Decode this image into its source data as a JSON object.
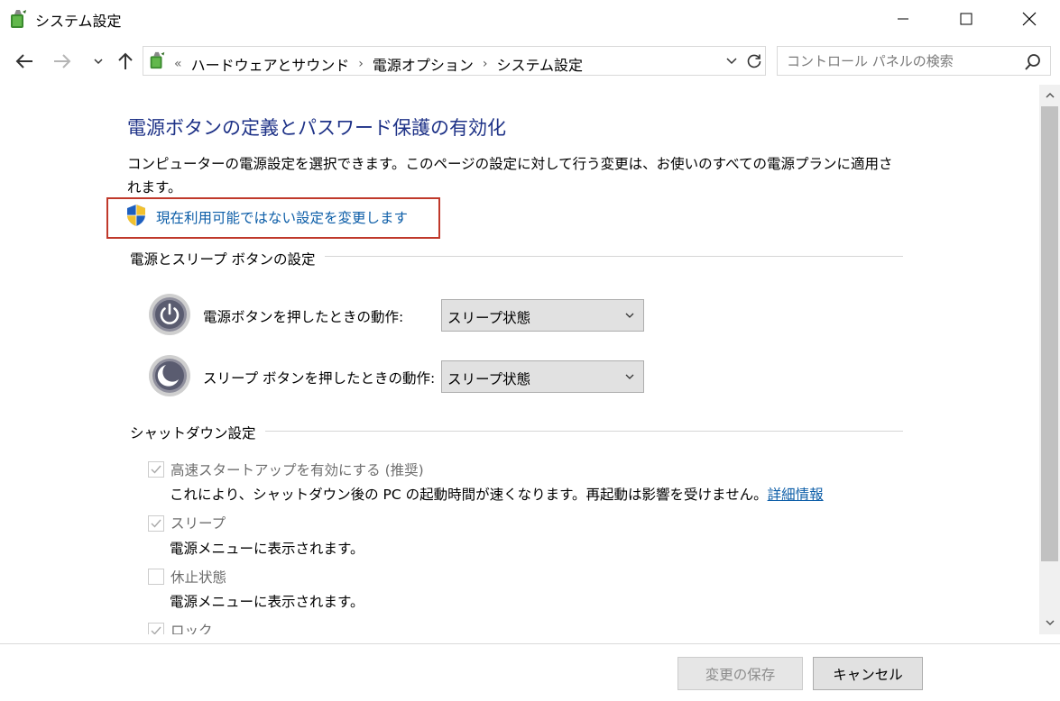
{
  "window": {
    "title": "システム設定"
  },
  "address": {
    "overflow": "«",
    "crumbs": [
      "ハードウェアとサウンド",
      "電源オプション",
      "システム設定"
    ],
    "separator": "›"
  },
  "search": {
    "placeholder": "コントロール パネルの検索"
  },
  "main": {
    "title": "電源ボタンの定義とパスワード保護の有効化",
    "description": "コンピューターの電源設定を選択できます。このページの設定に対して行う変更は、お使いのすべての電源プランに適用されます。",
    "change_link": "現在利用可能ではない設定を変更します",
    "power_group": {
      "heading": "電源とスリープ ボタンの設定",
      "power_button_label": "電源ボタンを押したときの動作:",
      "power_button_value": "スリープ状態",
      "sleep_button_label": "スリープ ボタンを押したときの動作:",
      "sleep_button_value": "スリープ状態"
    },
    "shutdown_group": {
      "heading": "シャットダウン設定",
      "items": [
        {
          "label": "高速スタートアップを有効にする (推奨)",
          "desc": "これにより、シャットダウン後の PC の起動時間が速くなります。再起動は影響を受けません。",
          "link": "詳細情報",
          "checked": true
        },
        {
          "label": "スリープ",
          "desc": "電源メニューに表示されます。",
          "checked": true
        },
        {
          "label": "休止状態",
          "desc": "電源メニューに表示されます。",
          "checked": false
        },
        {
          "label": "ロック",
          "checked": true
        }
      ]
    }
  },
  "footer": {
    "save_label": "変更の保存",
    "cancel_label": "キャンセル"
  },
  "colors": {
    "title_blue": "#1e3287",
    "link_blue": "#0d5ea8",
    "highlight_red": "#c0392b"
  }
}
